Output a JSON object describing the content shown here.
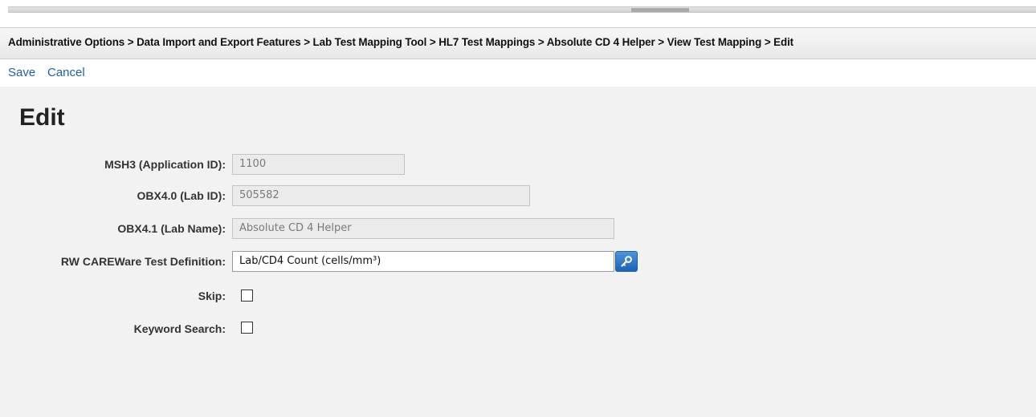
{
  "breadcrumb": {
    "text": "Administrative Options > Data Import and Export Features > Lab Test Mapping Tool > HL7 Test Mappings > Absolute CD 4 Helper > View Test Mapping > Edit"
  },
  "actions": {
    "save_label": "Save",
    "cancel_label": "Cancel"
  },
  "page": {
    "title": "Edit"
  },
  "form": {
    "msh3": {
      "label": "MSH3 (Application ID):",
      "value": "1100"
    },
    "obx40": {
      "label": "OBX4.0 (Lab ID):",
      "value": "505582"
    },
    "obx41": {
      "label": "OBX4.1 (Lab Name):",
      "value": "Absolute CD 4 Helper"
    },
    "test_definition": {
      "label": "RW CAREWare Test Definition:",
      "value": "Lab/CD4 Count (cells/mm³)",
      "lookup_icon": "key-icon"
    },
    "skip": {
      "label": "Skip:",
      "checked": false
    },
    "keyword_search": {
      "label": "Keyword Search:",
      "checked": false
    }
  },
  "colors": {
    "link": "#1f5ea8",
    "lookup_button": "#1d62b4"
  }
}
